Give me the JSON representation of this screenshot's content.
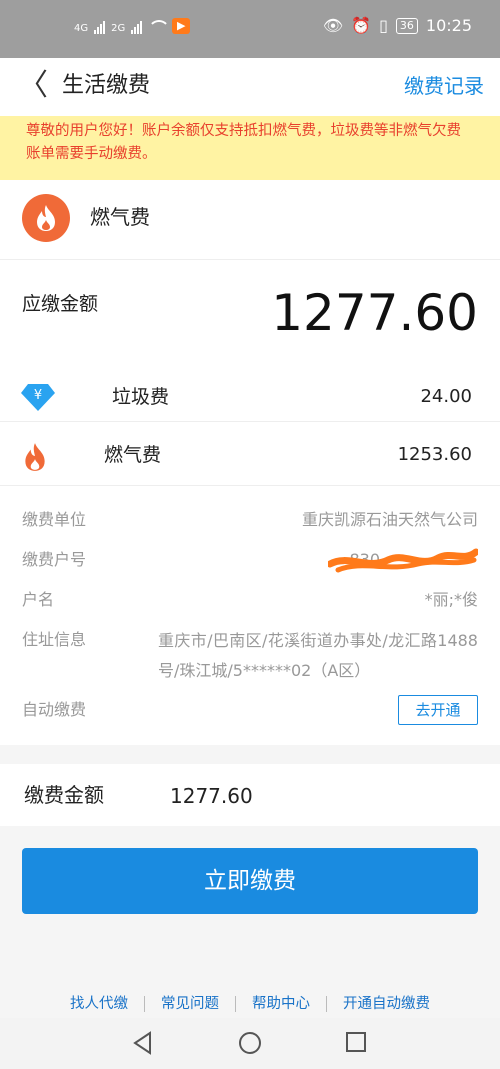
{
  "status_bar": {
    "network1": "4G",
    "network2": "2G",
    "battery": "36",
    "time": "10:25"
  },
  "header": {
    "back_glyph": "〈",
    "title": "生活缴费",
    "history_link": "缴费记录"
  },
  "notice": {
    "text": "尊敬的用户您好！账户余额仅支持抵扣燃气费，垃圾费等非燃气欠费账单需要手动缴费。"
  },
  "bill": {
    "service_name": "燃气费",
    "due_label": "应缴金额",
    "due_amount": "1277.60",
    "items": [
      {
        "name": "垃圾费",
        "amount": "24.00",
        "icon": "diamond-yen-icon",
        "color": "#2aa3f0"
      },
      {
        "name": "燃气费",
        "amount": "1253.60",
        "icon": "flame-icon",
        "color": "#f06a38"
      }
    ],
    "details": [
      {
        "label": "缴费单位",
        "value": "重庆凯源石油天然气公司"
      },
      {
        "label": "缴费户号",
        "value": "830"
      },
      {
        "label": "户名",
        "value": "*丽;*俊"
      },
      {
        "label": "住址信息",
        "value": "重庆市/巴南区/花溪街道办事处/龙汇路1488号/珠江城/5******02（A区）"
      },
      {
        "label": "自动缴费",
        "button": "去开通"
      }
    ]
  },
  "payment": {
    "label": "缴费金额",
    "value": "1277.60",
    "button": "立即缴费"
  },
  "footer_links": [
    "找人代缴",
    "常见问题",
    "帮助中心",
    "开通自动缴费"
  ],
  "colors": {
    "accent": "#1a8be0",
    "notice_bg": "#fff3a3",
    "notice_text": "#e8402d",
    "flame": "#f06a38"
  }
}
